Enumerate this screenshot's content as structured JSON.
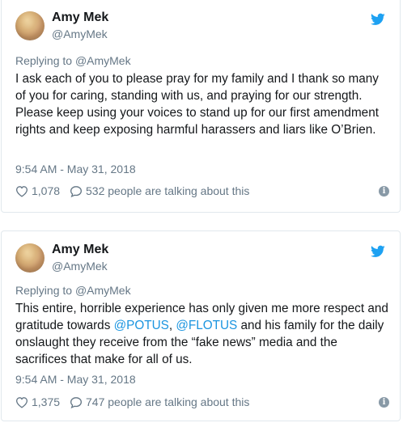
{
  "tweets": [
    {
      "name": "Amy Mek",
      "handle": "@AmyMek",
      "replying_prefix": "Replying to ",
      "replying_handle": "@AmyMek",
      "body": [
        {
          "t": "I ask each of you to please pray for my family and I thank so many of you for caring, standing with us, and praying for our strength. Please keep using your voices to stand up for our first amendment rights and keep exposing harmful harassers and liars like O’Brien.",
          "m": false
        }
      ],
      "timestamp": "9:54 AM - May 31, 2018",
      "likes": "1,078",
      "talking": "532 people are talking about this",
      "info_glyph": "i"
    },
    {
      "name": "Amy Mek",
      "handle": "@AmyMek",
      "replying_prefix": "Replying to ",
      "replying_handle": "@AmyMek",
      "body": [
        {
          "t": "This entire, horrible experience has only given me more respect and gratitude towards ",
          "m": false
        },
        {
          "t": "@POTUS",
          "m": true
        },
        {
          "t": ", ",
          "m": false
        },
        {
          "t": "@FLOTUS",
          "m": true
        },
        {
          "t": " and his family for the daily onslaught they receive from the “fake news” media and the sacrifices that make for all of us.",
          "m": false
        }
      ],
      "timestamp": "9:54 AM - May 31, 2018",
      "likes": "1,375",
      "talking": "747 people are talking about this",
      "info_glyph": "i"
    }
  ],
  "icons": {
    "bird": "twitter-bird-icon",
    "heart": "heart-icon",
    "reply": "speech-bubble-icon",
    "info": "info-icon"
  },
  "colors": {
    "twitter_blue": "#1da1f2",
    "mention": "#1b95e0",
    "secondary_text": "#657786",
    "primary_text": "#14171a"
  }
}
